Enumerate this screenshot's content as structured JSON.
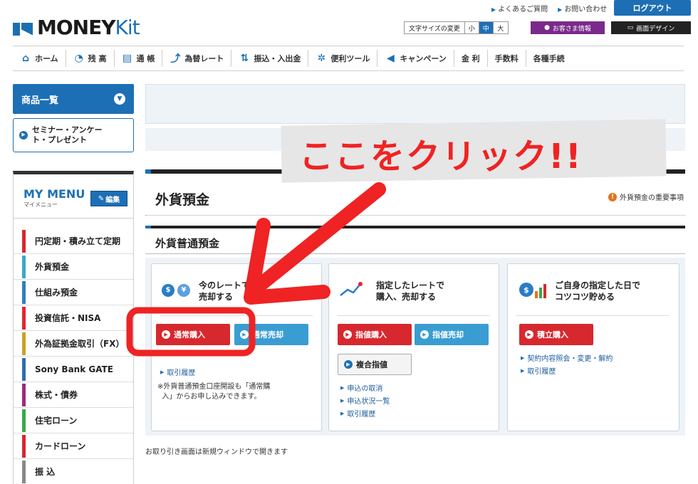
{
  "header": {
    "faq": "よくあるご質問",
    "contact": "お問い合わせ",
    "logout": "ログアウト",
    "logo_money": "MONEY",
    "logo_kit": "Kit",
    "font_size_label": "文字サイズの変更",
    "font_sizes": [
      "小",
      "中",
      "大"
    ],
    "customer_info": "お客さま情報",
    "screen_design": "画面デザイン"
  },
  "gnav": [
    {
      "label": "ホーム",
      "icon": "home-icon"
    },
    {
      "label": "残 高",
      "icon": "pie-chart-icon"
    },
    {
      "label": "通 帳",
      "icon": "passbook-icon"
    },
    {
      "label": "為替レート",
      "icon": "trend-icon"
    },
    {
      "label": "振込・入出金",
      "icon": "transfer-arrows-icon"
    },
    {
      "label": "便利ツール",
      "icon": "gears-icon"
    },
    {
      "label": "キャンペーン",
      "icon": "megaphone-icon"
    },
    {
      "label": "金 利",
      "icon": ""
    },
    {
      "label": "手数料",
      "icon": ""
    },
    {
      "label": "各種手続",
      "icon": ""
    }
  ],
  "sidebar": {
    "products": "商品一覧",
    "seminar_line1": "セミナー・アンケー",
    "seminar_line2": "ト・プレゼント",
    "mymenu_title": "MY MENU",
    "mymenu_sub": "マイメニュー",
    "edit": "編集",
    "items": [
      {
        "label": "円定期・積み立て定期",
        "color": "#d9282f"
      },
      {
        "label": "外貨預金",
        "color": "#3aa9c9"
      },
      {
        "label": "仕組み預金",
        "color": "#2f7fc4"
      },
      {
        "label": "投資信託・NISA",
        "color": "#e3262c"
      },
      {
        "label": "外為証拠金取引（FX）",
        "color": "#c9a227"
      },
      {
        "label": "Sony Bank GATE",
        "color": "#2d6db3"
      },
      {
        "label": "株式・債券",
        "color": "#a02a7e"
      },
      {
        "label": "住宅ローン",
        "color": "#3aa84a"
      },
      {
        "label": "カードローン",
        "color": "#d9282f"
      },
      {
        "label": "振 込",
        "color": "#888888"
      }
    ]
  },
  "main": {
    "page_title": "外貨預金",
    "important": "外貨預金の重要事項",
    "section_title": "外貨普通預金",
    "card1": {
      "line1": "今のレートで",
      "line2": "売却する",
      "buy": "通常購入",
      "sell": "通常売却",
      "link_history": "取引履歴",
      "note_line1": "※外貨普通預金口座開設も「通常購",
      "note_line2": "入」からお申し込みできます。"
    },
    "card2": {
      "line1": "指定したレートで",
      "line2": "購入、売却する",
      "buy": "指値購入",
      "sell": "指値売却",
      "compound": "複合指値",
      "link_cancel": "申込の取消",
      "link_status": "申込状況一覧",
      "link_history": "取引履歴"
    },
    "card3": {
      "line1": "ご自身の指定した日で",
      "line2": "コツコツ貯める",
      "buy": "積立購入",
      "link_contract": "契約内容照会・変更・解約",
      "link_history": "取引履歴"
    },
    "footer_note": "お取り引き画面は新規ウィンドウで開きます"
  },
  "annotation": {
    "text": "ここをクリック!!",
    "color": "#ef2323"
  }
}
